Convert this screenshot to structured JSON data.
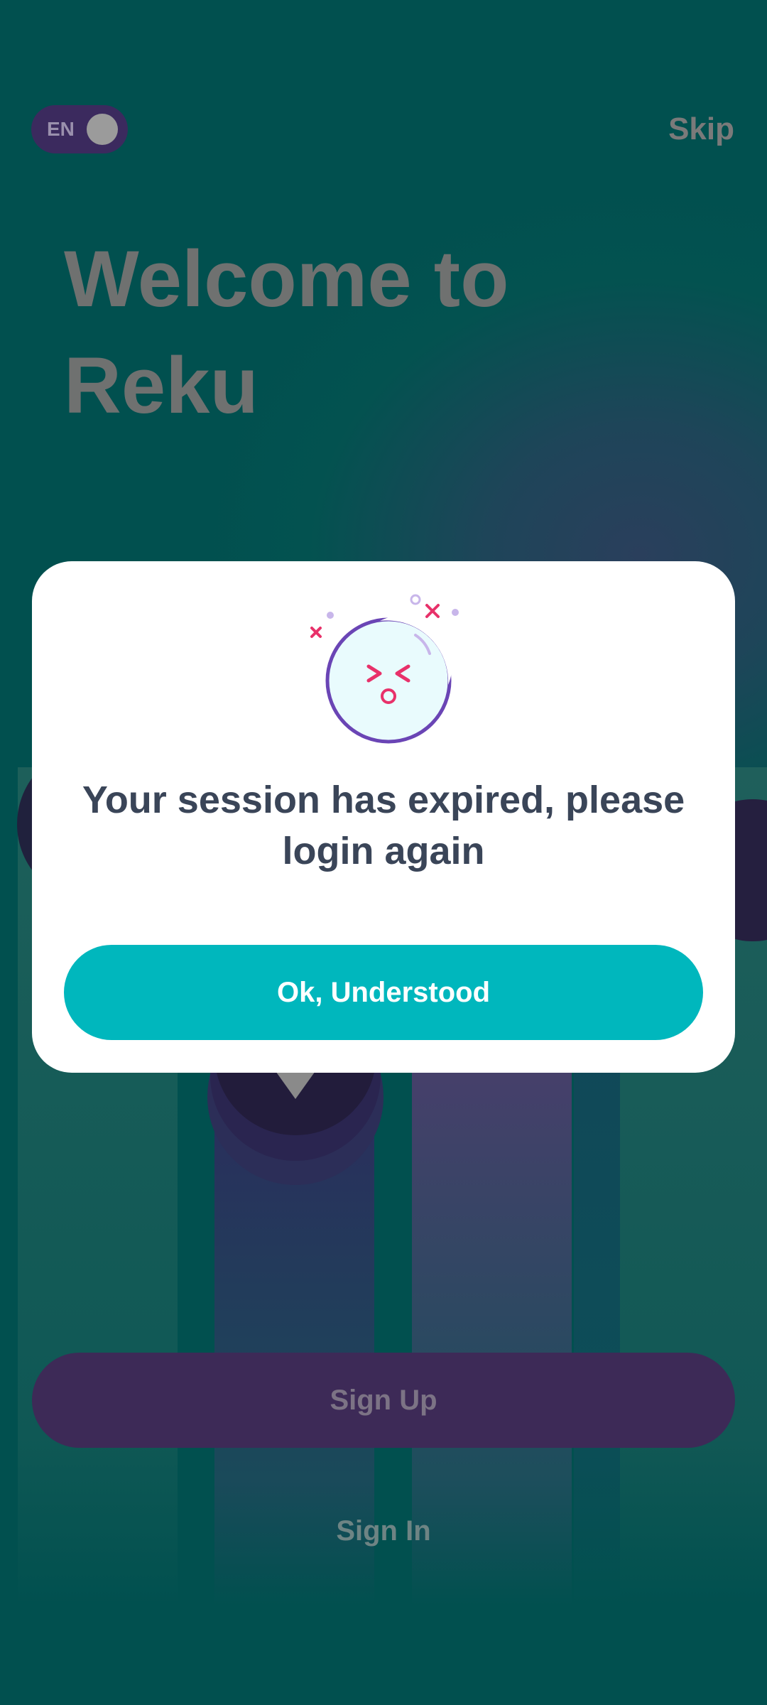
{
  "colors": {
    "background": "#01504f",
    "dialog_background": "#ffffff",
    "primary_button": "#00b7bd",
    "signup_button": "#3d2a57",
    "message_text": "#3a4558",
    "icon_outline": "#6a45b5",
    "icon_accent": "#e8316a"
  },
  "header": {
    "language_toggle": {
      "label": "EN",
      "icon": "toggle-knob"
    },
    "skip_label": "Skip"
  },
  "welcome": {
    "line1": "Welcome to",
    "line2": "Reku"
  },
  "auth": {
    "signup_label": "Sign Up",
    "signin_label": "Sign In"
  },
  "dialog": {
    "illustration_icon": "dizzy-face-icon",
    "message": "Your session has expired, please login again",
    "confirm_label": "Ok, Understood"
  }
}
